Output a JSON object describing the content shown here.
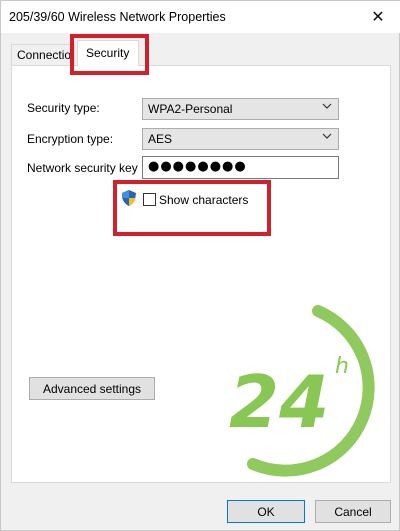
{
  "window": {
    "title": "205/39/60 Wireless Network Properties",
    "close_glyph": "✕"
  },
  "tabs": [
    {
      "label": "Connection",
      "active": false
    },
    {
      "label": "Security",
      "active": true
    }
  ],
  "security": {
    "security_type_label": "Security type:",
    "security_type_value": "WPA2-Personal",
    "encryption_type_label": "Encryption type:",
    "encryption_type_value": "AES",
    "key_label": "Network security key",
    "key_value": "●●●●●●●●",
    "show_characters_label": "Show characters",
    "show_characters_checked": false
  },
  "buttons": {
    "advanced_settings": "Advanced settings",
    "ok": "OK",
    "cancel": "Cancel"
  },
  "watermark": {
    "number": "24",
    "superscript": "h",
    "color": "#7cc142"
  },
  "highlight_color": "#d0202a",
  "icons": {
    "dropdown": "chevron-down-icon",
    "uac_shield": "shield-icon",
    "close": "close-icon"
  }
}
